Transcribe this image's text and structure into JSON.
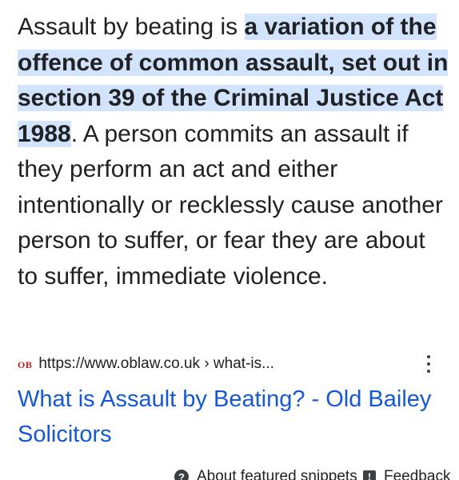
{
  "snippet": {
    "lead": "Assault by beating is ",
    "highlight": "a variation of the offence of common assault, set out in section 39 of the Criminal Justice Act 1988",
    "rest": ". A person commits an assault if they perform an act and either intentionally or recklessly cause another person to suffer, or fear they are about to suffer, immediate violence."
  },
  "source": {
    "favicon_text": "OB",
    "url": "https://www.oblaw.co.uk › what-is..."
  },
  "result": {
    "title": "What is Assault by Beating? - Old Bailey Solicitors"
  },
  "footer": {
    "about_label": "About featured snippets",
    "feedback_label": "Feedback"
  },
  "colors": {
    "highlight_bg": "#d2e3fc",
    "link": "#1558d6",
    "text": "#202124"
  },
  "icons": {
    "help": "help-icon",
    "feedback": "feedback-icon",
    "menu": "more-vert-icon"
  }
}
